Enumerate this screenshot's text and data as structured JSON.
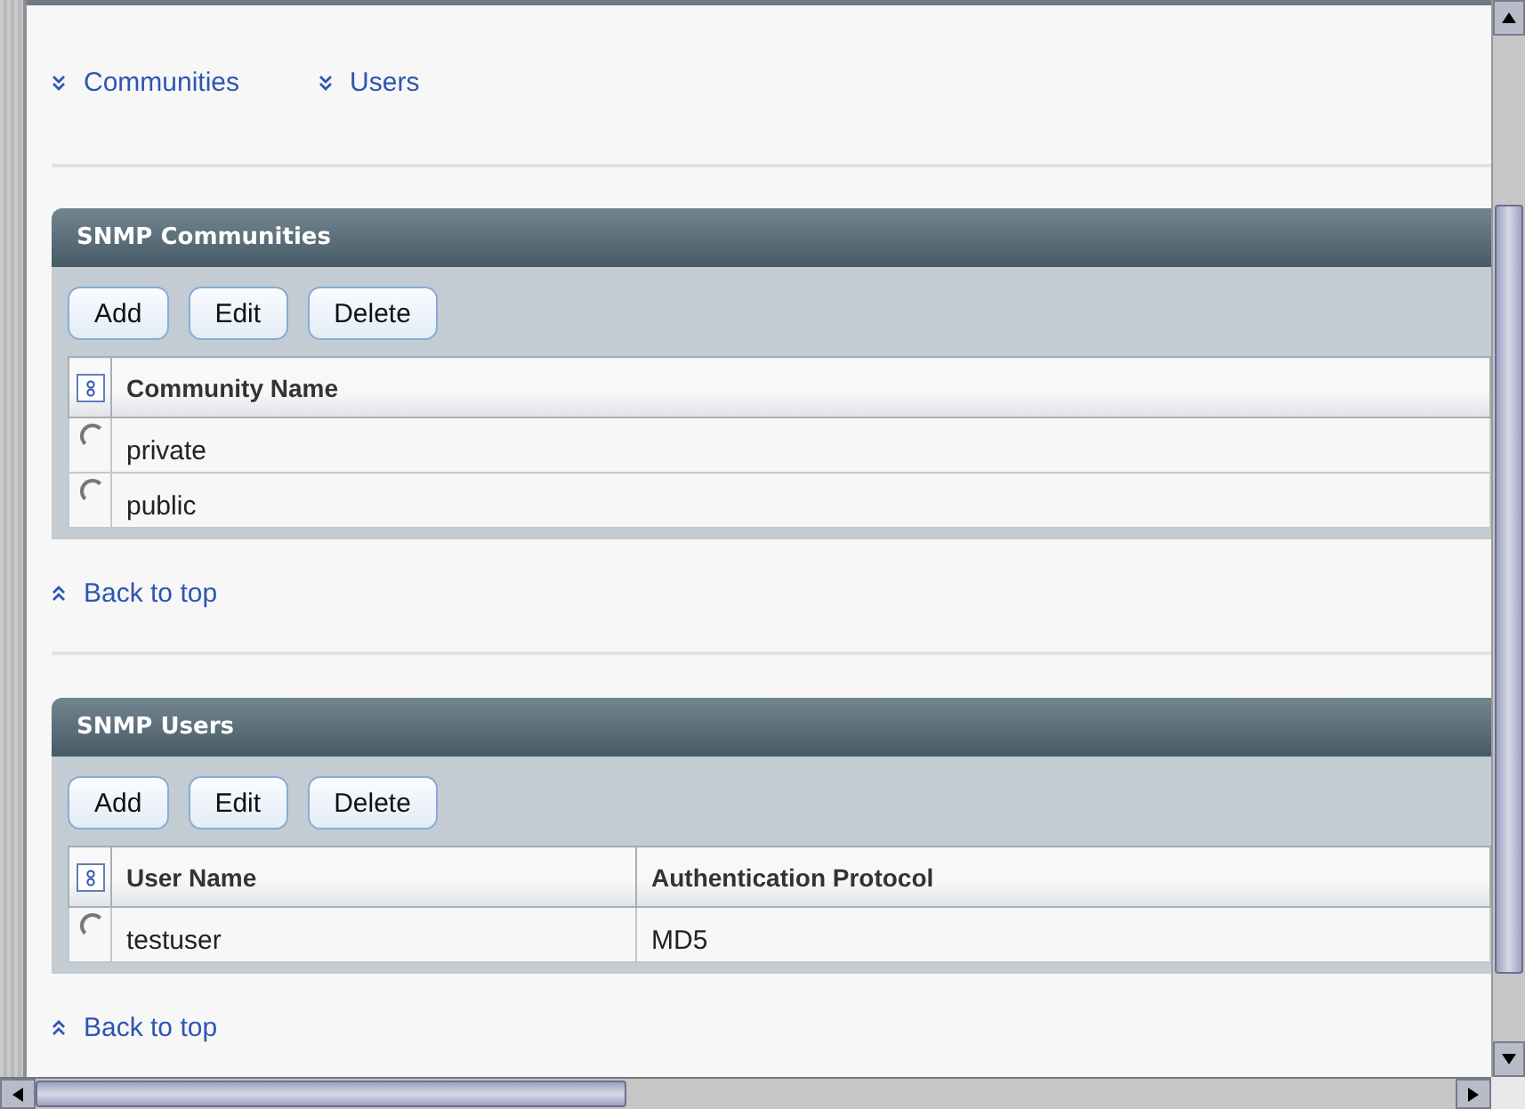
{
  "jump_links": [
    {
      "label": "Communities"
    },
    {
      "label": "Users"
    }
  ],
  "sections": [
    {
      "title": "SNMP Communities",
      "buttons": [
        "Add",
        "Edit",
        "Delete"
      ],
      "columns": [
        "Community Name"
      ],
      "rows": [
        {
          "selected": false,
          "cells": [
            "private"
          ]
        },
        {
          "selected": false,
          "cells": [
            "public"
          ]
        }
      ],
      "back_link": "Back to top"
    },
    {
      "title": "SNMP Users",
      "buttons": [
        "Add",
        "Edit",
        "Delete"
      ],
      "columns": [
        "User Name",
        "Authentication Protocol"
      ],
      "rows": [
        {
          "selected": false,
          "cells": [
            "testuser",
            "MD5"
          ]
        }
      ],
      "back_link": "Back to top"
    }
  ]
}
